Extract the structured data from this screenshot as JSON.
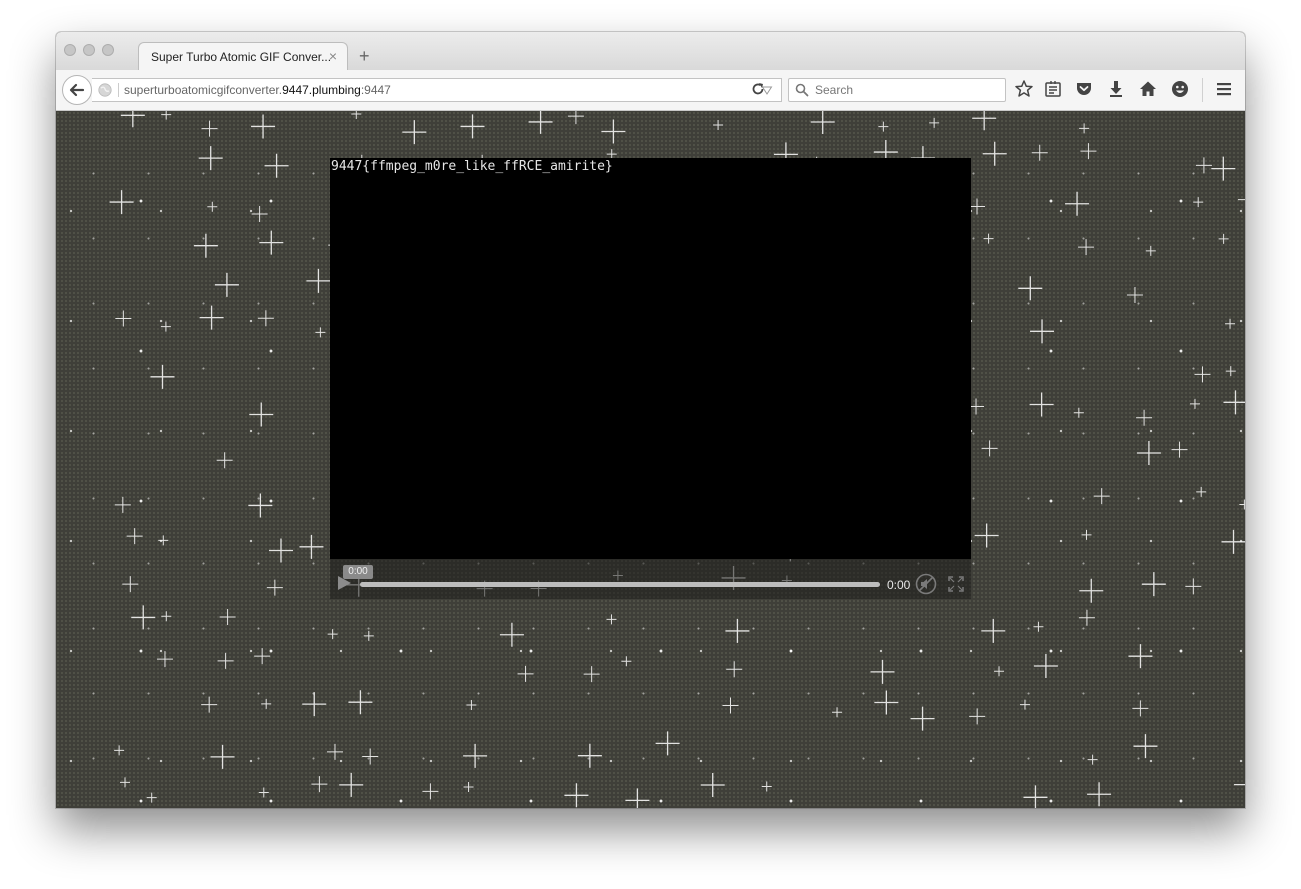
{
  "browser": {
    "tab": {
      "title": "Super Turbo Atomic GIF Conver...",
      "close": "×"
    },
    "new_tab": "+",
    "url": {
      "prefix": "superturboatomicgifconverter.",
      "host": "9447.plumbing",
      "port": ":9447"
    },
    "search": {
      "placeholder": "Search"
    },
    "toolbar_icons": [
      "bookmark-star-icon",
      "reading-list-icon",
      "pocket-icon",
      "download-icon",
      "home-icon",
      "smiley-icon",
      "menu-icon"
    ]
  },
  "page": {
    "video": {
      "overlay_text": "9447{ffmpeg_m0re_like_ffRCE_amirite}",
      "tooltip_time": "0:00",
      "current_time": "0:00",
      "progress": 0
    }
  }
}
